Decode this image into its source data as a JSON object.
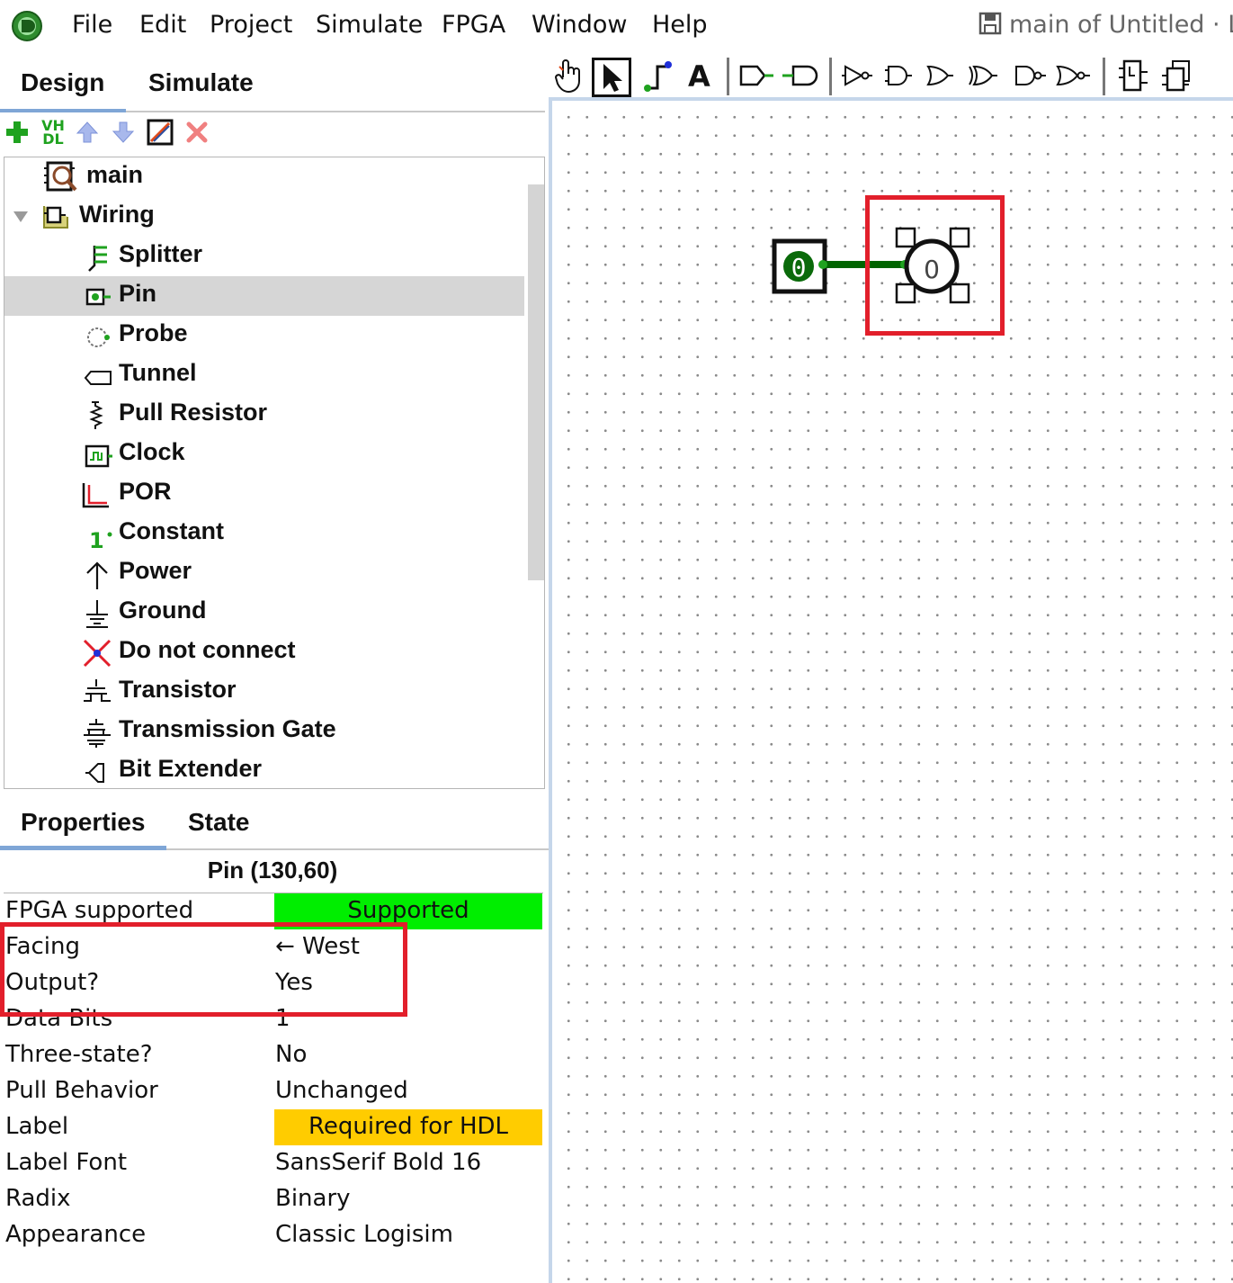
{
  "menubar": {
    "items": [
      "File",
      "Edit",
      "Project",
      "Simulate",
      "FPGA",
      "Window",
      "Help"
    ],
    "window_title": "main of Untitled · Lo"
  },
  "left_tabs": {
    "design": "Design",
    "simulate": "Simulate"
  },
  "left_toolbar": {
    "vhdl_label": "VH DL"
  },
  "tree": {
    "root": "main",
    "folder": "Wiring",
    "items": [
      "Splitter",
      "Pin",
      "Probe",
      "Tunnel",
      "Pull Resistor",
      "Clock",
      "POR",
      "Constant",
      "Power",
      "Ground",
      "Do not connect",
      "Transistor",
      "Transmission Gate",
      "Bit Extender"
    ],
    "selected": "Pin"
  },
  "bottom_tabs": {
    "properties": "Properties",
    "state": "State"
  },
  "properties": {
    "title": "Pin (130,60)",
    "rows": [
      {
        "key": "FPGA supported",
        "value": "Supported"
      },
      {
        "key": "Facing",
        "value": "← West"
      },
      {
        "key": "Output?",
        "value": "Yes"
      },
      {
        "key": "Data Bits",
        "value": "1"
      },
      {
        "key": "Three-state?",
        "value": "No"
      },
      {
        "key": "Pull Behavior",
        "value": "Unchanged"
      },
      {
        "key": "Label",
        "value": "Required for HDL"
      },
      {
        "key": "Label Font",
        "value": "SansSerif Bold 16"
      },
      {
        "key": "Radix",
        "value": "Binary"
      },
      {
        "key": "Appearance",
        "value": "Classic Logisim"
      }
    ]
  },
  "canvas": {
    "input_pin_value": "0",
    "output_pin_value": "0"
  },
  "colors": {
    "supported_badge": "#00ee00",
    "required_badge": "#ffcc00",
    "highlight": "#e21f2b",
    "wire": "#006400"
  }
}
